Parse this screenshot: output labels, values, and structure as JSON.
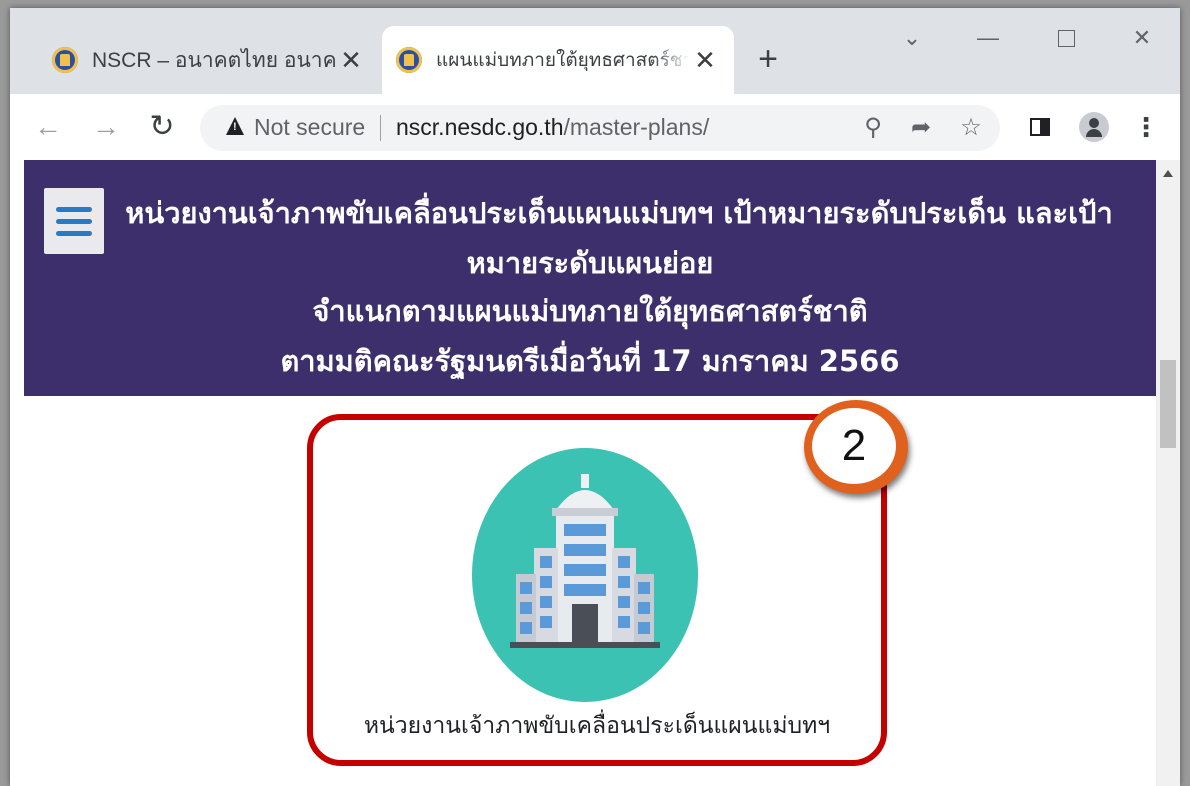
{
  "tabs": [
    {
      "title": "NSCR – อนาคตไทย อนาคตเรา",
      "active": false
    },
    {
      "title": "แผนแม่บทภายใต้ยุทธศาสตร์ชาติ",
      "active": true
    }
  ],
  "tab_icons": {
    "favicon": "nscr-logo-icon",
    "close": "close-icon",
    "new_tab": "plus-icon"
  },
  "window_controls": {
    "tab_search": "chevron-down-icon",
    "minimize": "minimize-icon",
    "maximize": "maximize-icon",
    "close": "close-icon"
  },
  "toolbar": {
    "security_label": "Not secure",
    "url_host": "nscr.nesdc.go.th",
    "url_path": "/master-plans/"
  },
  "banner": {
    "line1": "หน่วยงานเจ้าภาพขับเคลื่อนประเด็นแผนแม่บทฯ เป้าหมายระดับประเด็น และเป้า",
    "line2": "หมายระดับแผนย่อย",
    "line3": "จำแนกตามแผนแม่บทภายใต้ยุทธศาสตร์ชาติ",
    "line4": "ตามมติคณะรัฐมนตรีเมื่อวันที่ 17 มกราคม 2566"
  },
  "card": {
    "label": "หน่วยงานเจ้าภาพขับเคลื่อนประเด็นแผนแม่บทฯ",
    "icon": "government-building-icon"
  },
  "step_badge": "2",
  "colors": {
    "banner_bg": "#3d2f6b",
    "highlight_border": "#c40000",
    "badge_ring": "#e0611e",
    "icon_circle": "#3cc2b3"
  }
}
